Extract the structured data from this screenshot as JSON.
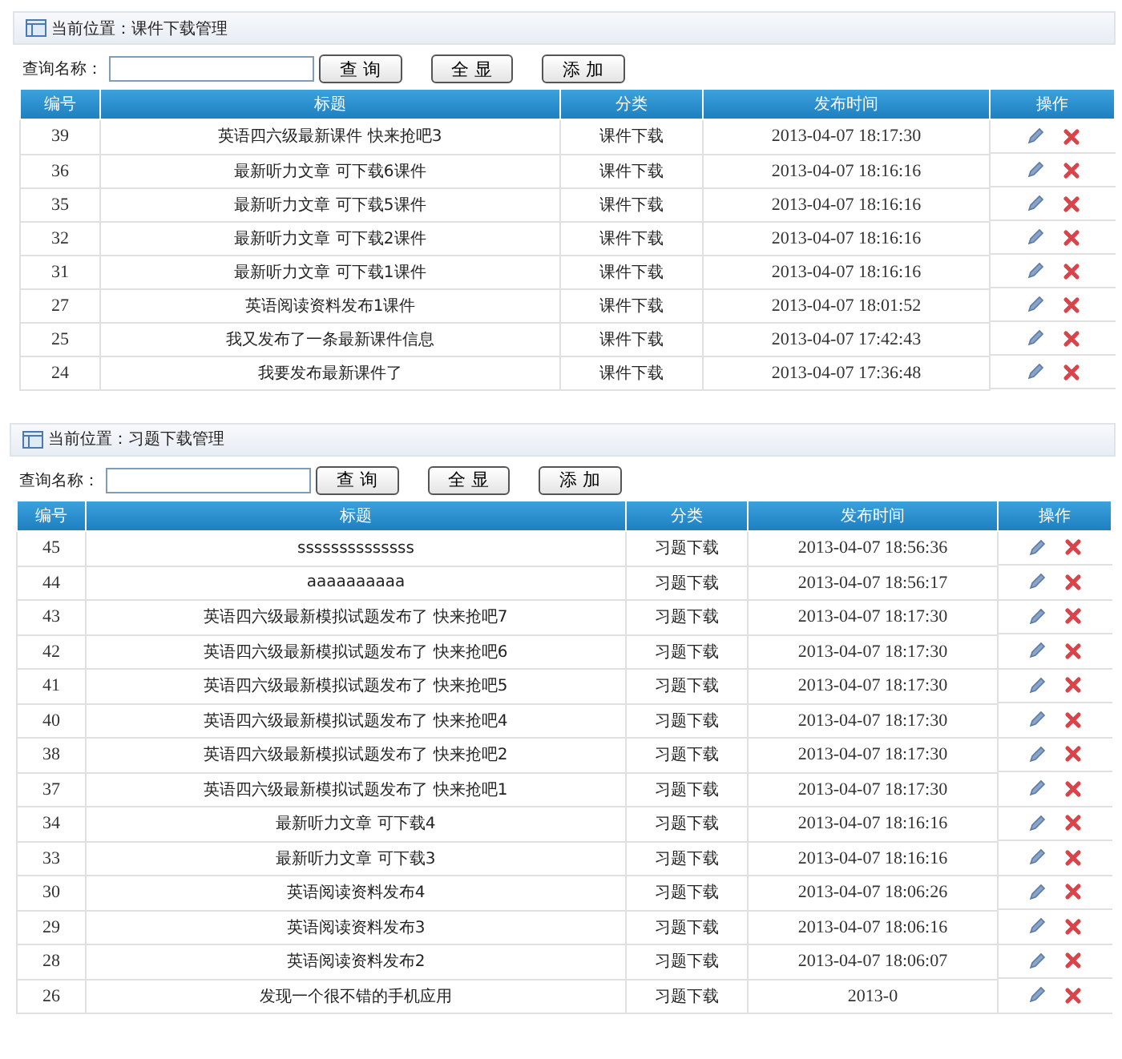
{
  "sections": [
    {
      "location_label": "当前位置：",
      "location": "课件下载管理",
      "search": {
        "label": "查询名称："
      },
      "buttons": [
        "查 询",
        "全 显",
        "添 加"
      ],
      "table": {
        "columns": [
          "编号",
          "标题",
          "分类",
          "发布时间",
          "操作"
        ],
        "rows": [
          {
            "id": "39",
            "title": "英语四六级最新课件  快来抢吧3",
            "category": "课件下载",
            "time": "2013-04-07 18:17:30"
          },
          {
            "id": "36",
            "title": "最新听力文章  可下载6课件",
            "category": "课件下载",
            "time": "2013-04-07 18:16:16"
          },
          {
            "id": "35",
            "title": "最新听力文章  可下载5课件",
            "category": "课件下载",
            "time": "2013-04-07 18:16:16"
          },
          {
            "id": "32",
            "title": "最新听力文章  可下载2课件",
            "category": "课件下载",
            "time": "2013-04-07 18:16:16"
          },
          {
            "id": "31",
            "title": "最新听力文章  可下载1课件",
            "category": "课件下载",
            "time": "2013-04-07 18:16:16"
          },
          {
            "id": "27",
            "title": "英语阅读资料发布1课件",
            "category": "课件下载",
            "time": "2013-04-07 18:01:52"
          },
          {
            "id": "25",
            "title": "我又发布了一条最新课件信息",
            "category": "课件下载",
            "time": "2013-04-07 17:42:43"
          },
          {
            "id": "24",
            "title": "我要发布最新课件了",
            "category": "课件下载",
            "time": "2013-04-07 17:36:48"
          }
        ]
      }
    },
    {
      "location_label": "当前位置：",
      "location": "习题下载管理",
      "search": {
        "label": "查询名称："
      },
      "buttons": [
        "查 询",
        "全 显",
        "添 加"
      ],
      "table": {
        "columns": [
          "编号",
          "标题",
          "分类",
          "发布时间",
          "操作"
        ],
        "rows": [
          {
            "id": "45",
            "title": "ssssssssssssss",
            "category": "习题下载",
            "time": "2013-04-07 18:56:36"
          },
          {
            "id": "44",
            "title": "aaaaaaaaaa",
            "category": "习题下载",
            "time": "2013-04-07 18:56:17"
          },
          {
            "id": "43",
            "title": "英语四六级最新模拟试题发布了  快来抢吧7",
            "category": "习题下载",
            "time": "2013-04-07 18:17:30"
          },
          {
            "id": "42",
            "title": "英语四六级最新模拟试题发布了  快来抢吧6",
            "category": "习题下载",
            "time": "2013-04-07 18:17:30"
          },
          {
            "id": "41",
            "title": "英语四六级最新模拟试题发布了  快来抢吧5",
            "category": "习题下载",
            "time": "2013-04-07 18:17:30"
          },
          {
            "id": "40",
            "title": "英语四六级最新模拟试题发布了  快来抢吧4",
            "category": "习题下载",
            "time": "2013-04-07 18:17:30"
          },
          {
            "id": "38",
            "title": "英语四六级最新模拟试题发布了  快来抢吧2",
            "category": "习题下载",
            "time": "2013-04-07 18:17:30"
          },
          {
            "id": "37",
            "title": "英语四六级最新模拟试题发布了  快来抢吧1",
            "category": "习题下载",
            "time": "2013-04-07 18:17:30"
          },
          {
            "id": "34",
            "title": "最新听力文章  可下载4",
            "category": "习题下载",
            "time": "2013-04-07 18:16:16"
          },
          {
            "id": "33",
            "title": "最新听力文章  可下载3",
            "category": "习题下载",
            "time": "2013-04-07 18:16:16"
          },
          {
            "id": "30",
            "title": "英语阅读资料发布4",
            "category": "习题下载",
            "time": "2013-04-07 18:06:26"
          },
          {
            "id": "29",
            "title": "英语阅读资料发布3",
            "category": "习题下载",
            "time": "2013-04-07 18:06:16"
          },
          {
            "id": "28",
            "title": "英语阅读资料发布2",
            "category": "习题下载",
            "time": "2013-04-07 18:06:07"
          },
          {
            "id": "26",
            "title": "发现一个很不错的手机应用",
            "category": "习题下载",
            "time": "2013-0"
          }
        ]
      }
    }
  ]
}
